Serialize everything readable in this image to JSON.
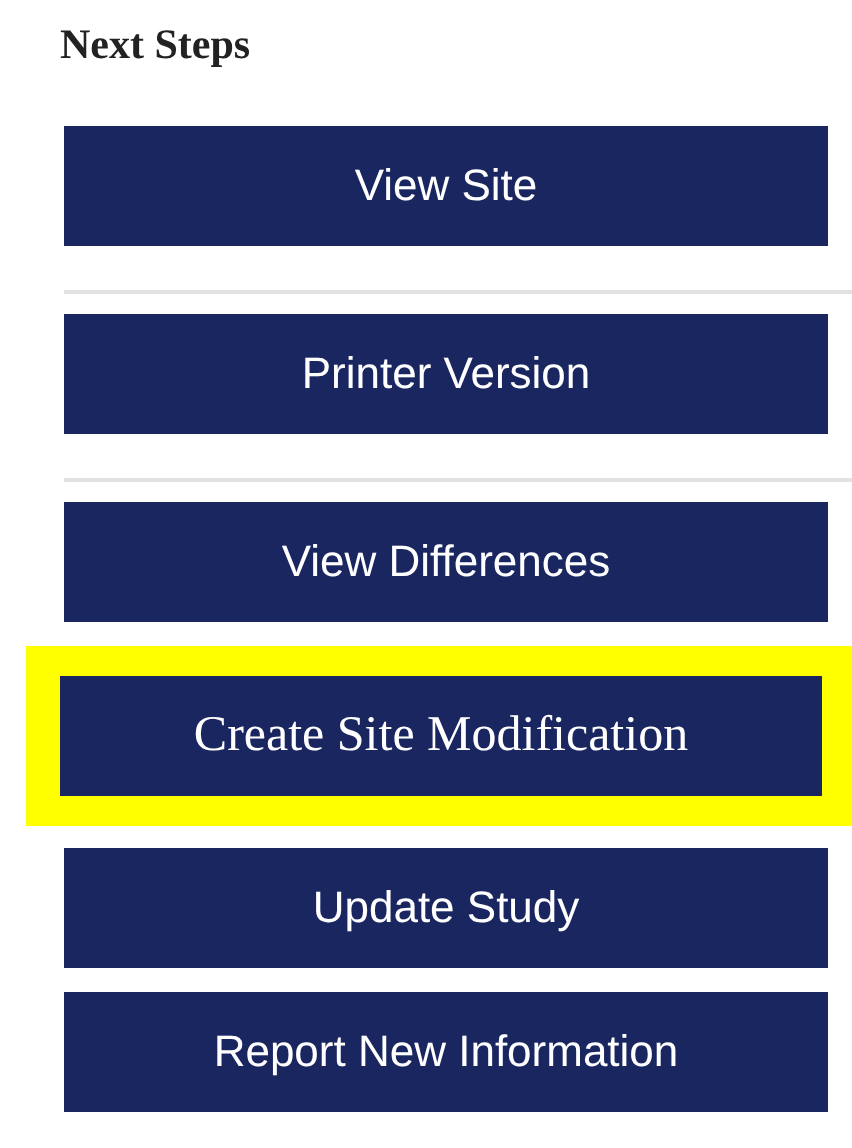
{
  "heading": "Next Steps",
  "items": [
    {
      "kind": "button",
      "label": "View Site",
      "highlighted": false
    },
    {
      "kind": "divider"
    },
    {
      "kind": "button",
      "label": "Printer Version",
      "highlighted": false
    },
    {
      "kind": "divider"
    },
    {
      "kind": "button",
      "label": "View Differences",
      "highlighted": false
    },
    {
      "kind": "button",
      "label": "Create Site Modification",
      "highlighted": true
    },
    {
      "kind": "button",
      "label": "Update Study",
      "highlighted": false
    },
    {
      "kind": "button",
      "label": "Report New Information",
      "highlighted": false
    }
  ]
}
